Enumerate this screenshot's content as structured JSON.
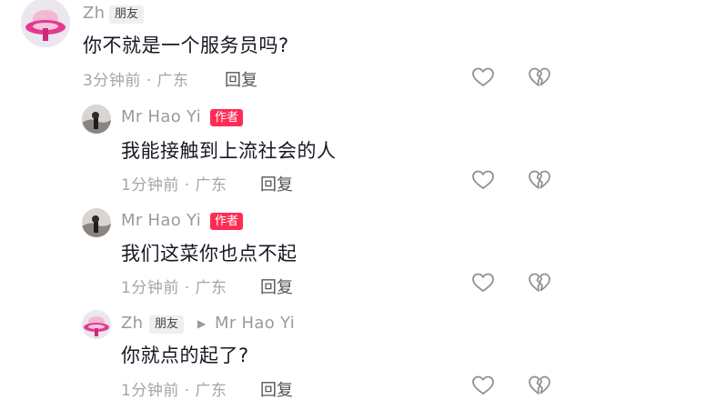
{
  "comments": [
    {
      "user": "Zh",
      "tag": "朋友",
      "text": "你不就是一个服务员吗?",
      "time_location": "3分钟前 · 广东",
      "reply_label": "回复"
    },
    {
      "user": "Mr Hao Yi",
      "tag": "作者",
      "text": "我能接触到上流社会的人",
      "time_location": "1分钟前 · 广东",
      "reply_label": "回复"
    },
    {
      "user": "Mr Hao Yi",
      "tag": "作者",
      "text": "我们这菜你也点不起",
      "time_location": "1分钟前 · 广东",
      "reply_label": "回复"
    },
    {
      "user": "Zh",
      "tag": "朋友",
      "reply_to": "Mr Hao Yi",
      "text": "你就点的起了?",
      "time_location": "1分钟前 · 广东",
      "reply_label": "回复"
    }
  ],
  "icons": {
    "like": "heart-outline-icon",
    "dislike": "broken-heart-icon",
    "reply_to": "play-triangle-icon"
  },
  "colors": {
    "author_tag": "#fe2c55",
    "friend_tag_bg": "#efefef",
    "meta": "#a5a5a5",
    "text": "#161823"
  }
}
